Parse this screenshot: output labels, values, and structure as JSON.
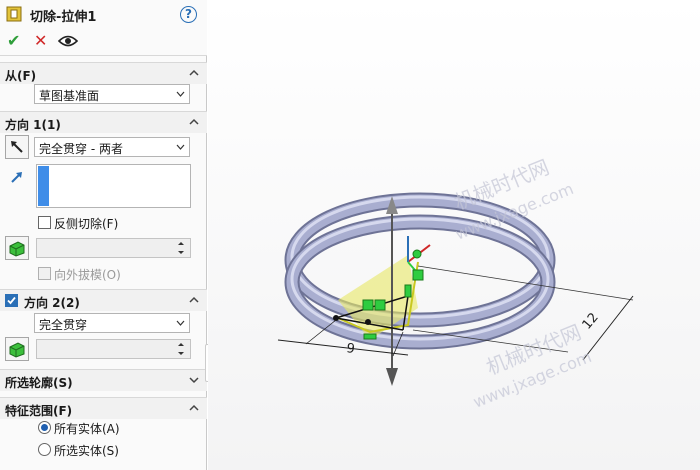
{
  "header": {
    "title": "切除-拉伸1",
    "help_label": "?",
    "ok_label": "✔",
    "cancel_label": "✕"
  },
  "from": {
    "section_label": "从(F)",
    "select_value": "草图基准面"
  },
  "direction1": {
    "section_label": "方向 1(1)",
    "end_condition": "完全贯穿 - 两者",
    "flip_side_label": "反侧切除(F)",
    "draft_outward_label": "向外拔模(O)"
  },
  "direction2": {
    "section_label": "方向 2(2)",
    "end_condition": "完全贯穿",
    "checked": true
  },
  "selected_contours": {
    "section_label": "所选轮廓(S)"
  },
  "feature_scope": {
    "section_label": "特征范围(F)",
    "options": [
      "所有实体(A)",
      "所选实体(S)"
    ],
    "selected": "所有实体(A)"
  },
  "viewport": {
    "dimension_width": "9",
    "dimension_length": "12",
    "watermark_line1": "机械时代网",
    "watermark_line2": "www.jxage.com"
  },
  "colors": {
    "accent": "#2a6fb6",
    "selection_blue": "#3f8de8",
    "ok_green": "#2f9e3a",
    "cancel_red": "#d02828",
    "sketch_highlight": "#e8e864",
    "sketch_relation_green": "#2ecc40",
    "ring_body": "#9ea3c4"
  }
}
